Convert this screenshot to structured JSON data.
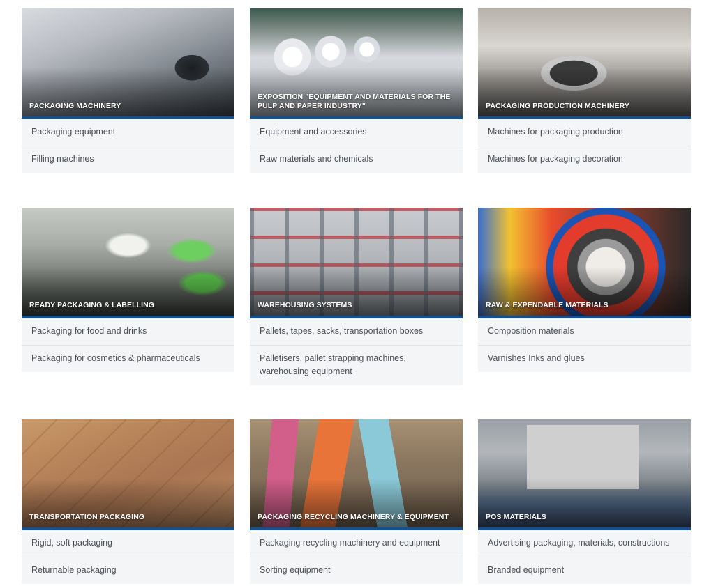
{
  "categories": [
    {
      "title": "PACKAGING MACHINERY",
      "items": [
        "Packaging equipment",
        "Filling machines"
      ]
    },
    {
      "title": "EXPOSITION \"EQUIPMENT AND MATERIALS FOR THE PULP AND PAPER INDUSTRY\"",
      "items": [
        "Equipment and accessories",
        "Raw materials and chemicals"
      ]
    },
    {
      "title": "PACKAGING PRODUCTION MACHINERY",
      "items": [
        "Machines for packaging production",
        "Machines for packaging decoration"
      ]
    },
    {
      "title": "READY PACKAGING & LABELLING",
      "items": [
        "Packaging for food and drinks",
        "Packaging for cosmetics & pharmaceuticals"
      ]
    },
    {
      "title": "WAREHOUSING SYSTEMS",
      "items": [
        "Pallets, tapes, sacks, transportation boxes",
        "Palletisers, pallet strapping machines, warehousing equipment"
      ]
    },
    {
      "title": "RAW & EXPENDABLE MATERIALS",
      "items": [
        "Composition materials",
        "Varnishes Inks and glues"
      ]
    },
    {
      "title": "TRANSPORTATION PACKAGING",
      "items": [
        "Rigid, soft packaging",
        "Returnable packaging"
      ]
    },
    {
      "title": "PACKAGING RECYCLING MACHINERY & EQUIPMENT",
      "items": [
        "Packaging recycling machinery and equipment",
        "Sorting equipment"
      ]
    },
    {
      "title": "POS MATERIALS",
      "items": [
        "Advertising packaging, materials, constructions",
        "Branded equipment"
      ]
    }
  ],
  "colors": {
    "accent_bar": "#134f93",
    "list_bg": "#f4f5f7",
    "list_text": "#4a4f55"
  }
}
